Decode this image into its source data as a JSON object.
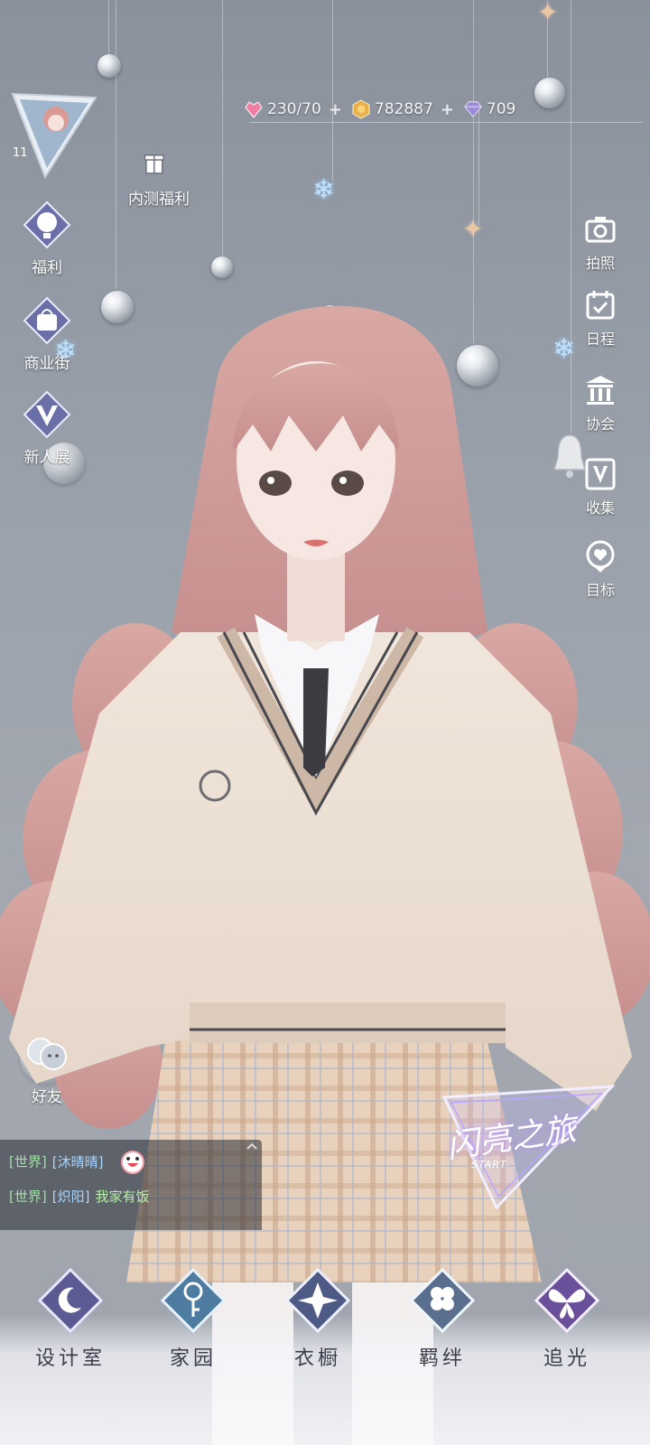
{
  "resources": {
    "stamina": {
      "value": "230/70",
      "icon": "heart-gem-icon",
      "has_plus": true
    },
    "gold": {
      "value": "782887",
      "icon": "gold-coin-icon",
      "has_plus": true
    },
    "diamond": {
      "value": "709",
      "icon": "diamond-icon",
      "has_plus": false
    },
    "plus_glyph": "+"
  },
  "player": {
    "level": "11"
  },
  "left_menu": {
    "beta_welfare": "内测福利",
    "welfare": "福利",
    "shop_street": "商业街",
    "new_show": "新人展",
    "friends": "好友"
  },
  "right_menu": {
    "photo": "拍照",
    "schedule": "日程",
    "guild": "协会",
    "collection": "收集",
    "goal": "目标"
  },
  "chat": {
    "messages": [
      {
        "channel": "[世界]",
        "name": "[沐晴晴]",
        "text": ""
      },
      {
        "channel": "[世界]",
        "name": "[炽阳]",
        "text": "我家有饭"
      }
    ]
  },
  "start_badge": {
    "title": "闪亮之旅",
    "sub": "START"
  },
  "bottom_nav": {
    "studio": "设计室",
    "home": "家园",
    "wardrobe": "衣橱",
    "bond": "羁绊",
    "chase_light": "追光"
  },
  "colors": {
    "accent_pink": "#f07ea0",
    "gold": "#e8b04a",
    "diamond": "#9a8ad8",
    "chat_tag": "#9fe0a6",
    "chat_name": "#a8d6ff"
  }
}
